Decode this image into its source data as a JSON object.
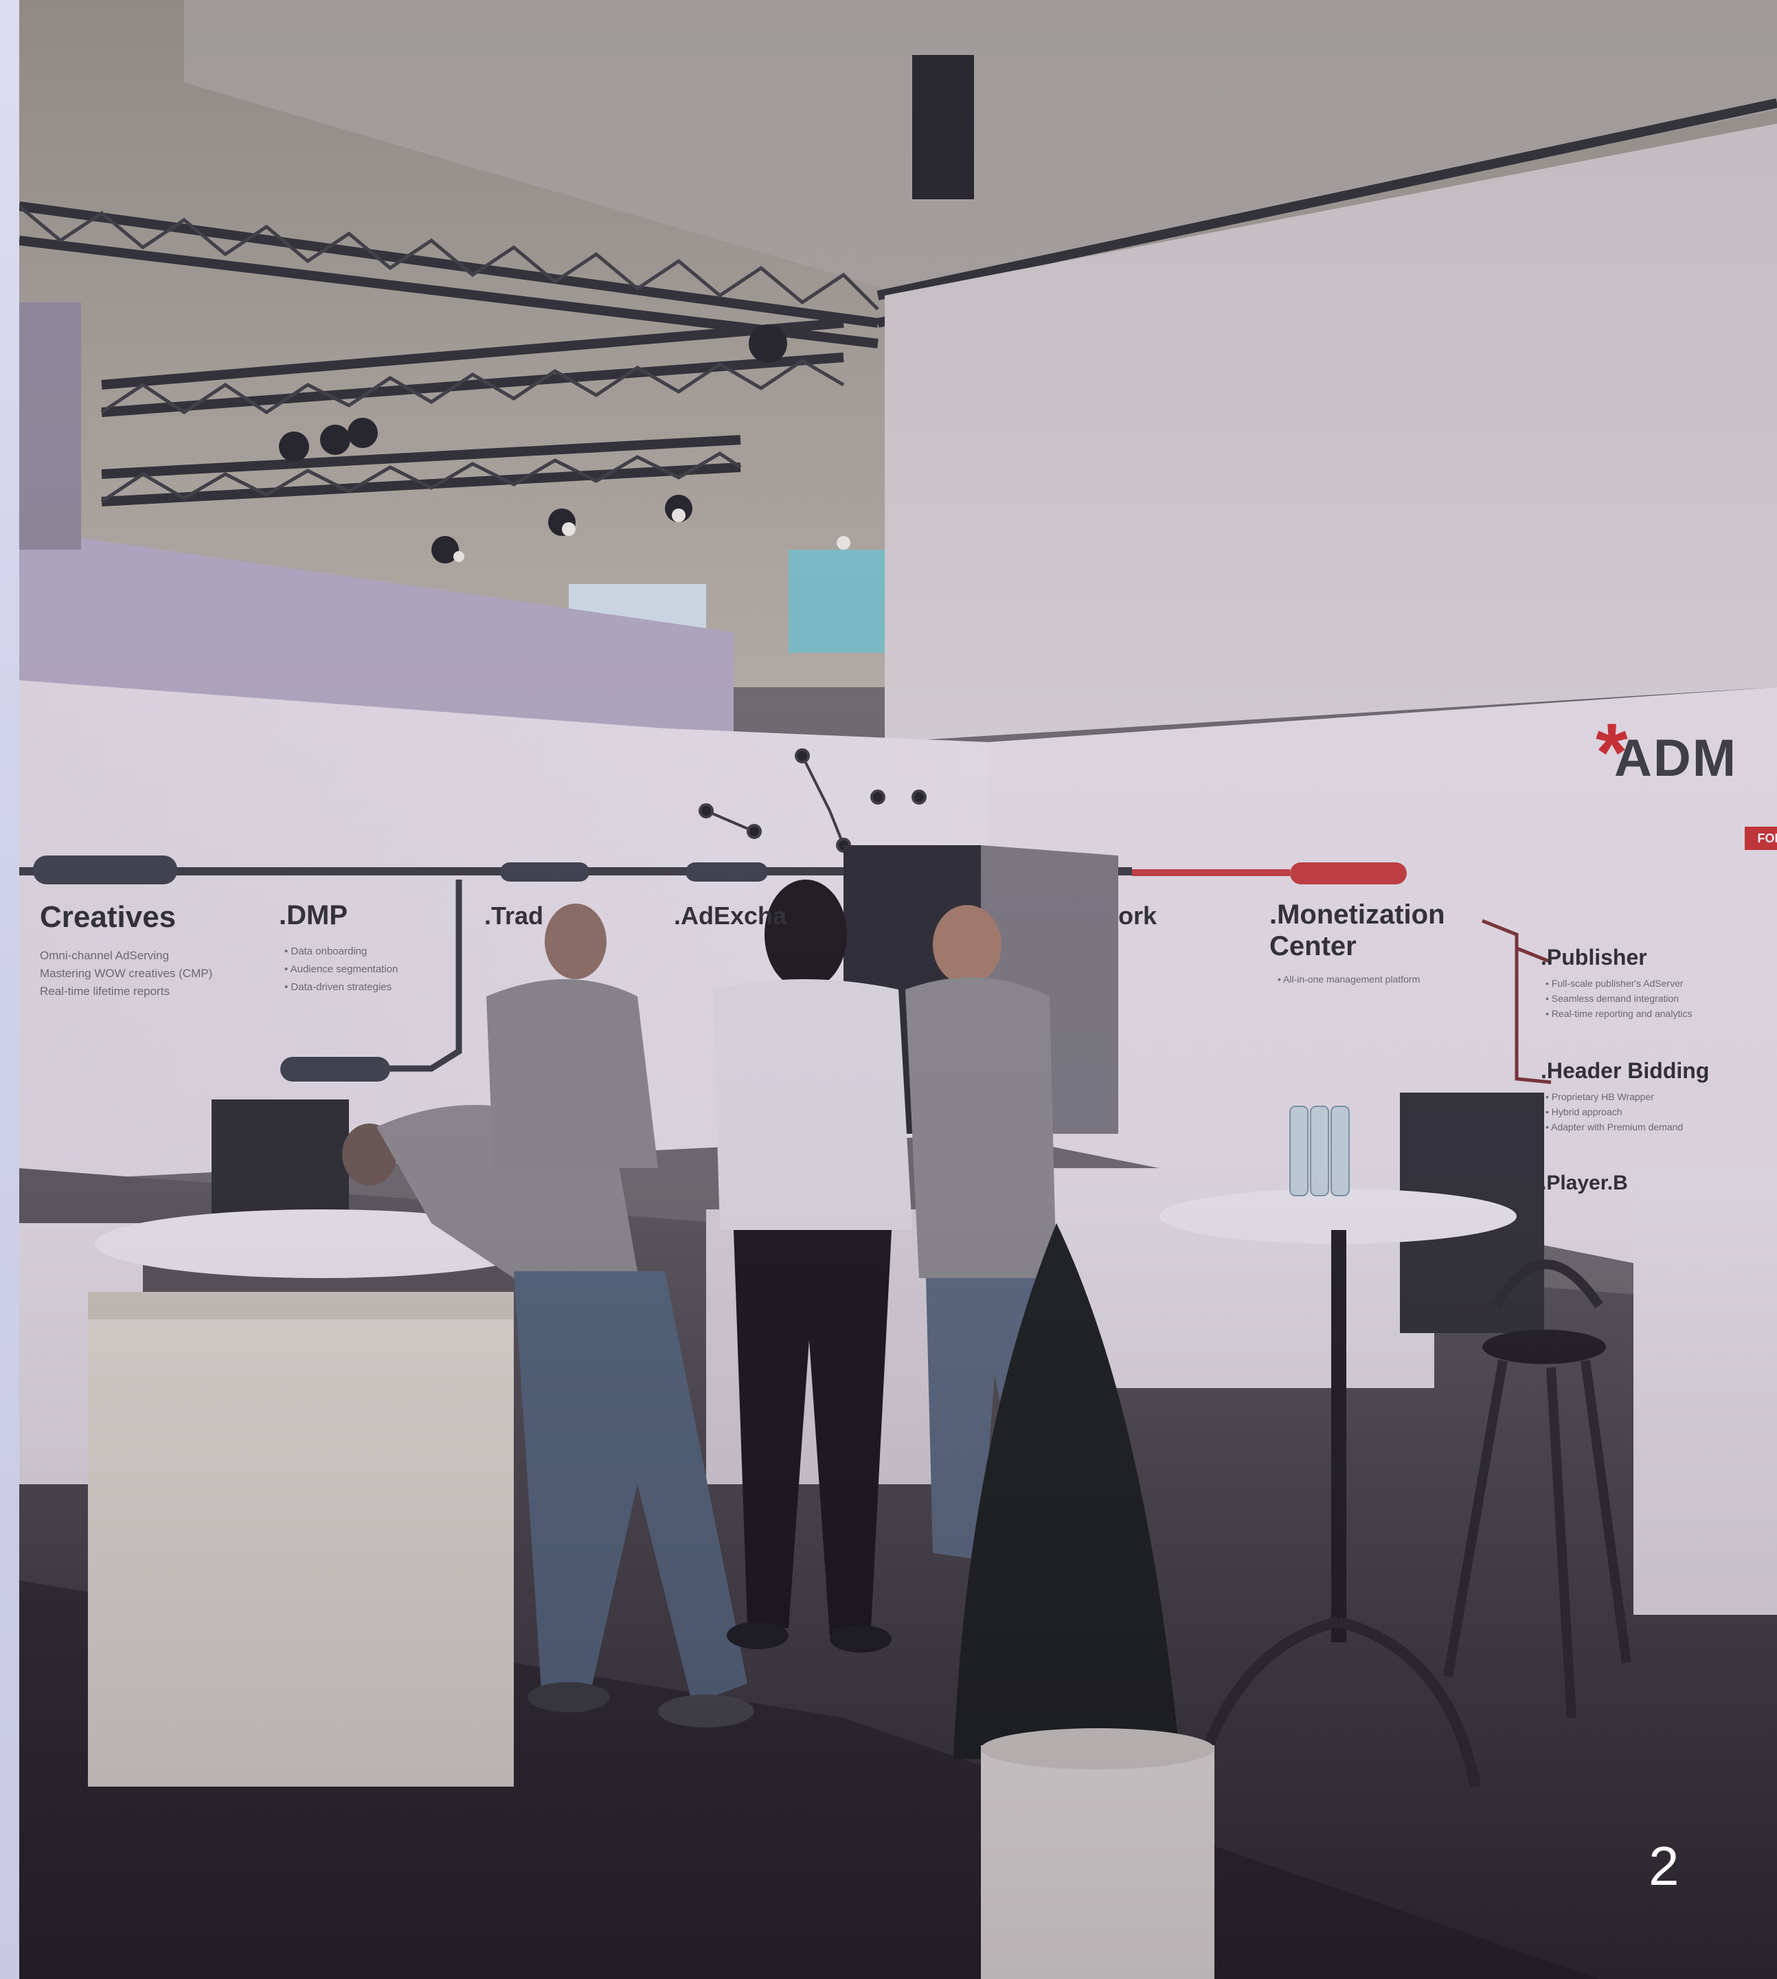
{
  "booth": {
    "brand": "ADM",
    "brand_tag": "FOR",
    "sections": [
      {
        "title": "Creatives",
        "subtitle": "Omni-channel AdServing\nMastering WOW creatives (CMP)\nReal-time lifetime reports"
      },
      {
        "title": ".DMP",
        "subtitle": "• Data onboarding\n• Audience segmentation\n• Data-driven strategies"
      },
      {
        "title": ".Trad",
        "subtitle": ""
      },
      {
        "title": ".AdExcha",
        "subtitle": ""
      },
      {
        "title": "ork",
        "subtitle": ""
      },
      {
        "title": ".Monetization\nCenter",
        "subtitle": "• All-in-one management platform"
      },
      {
        "title": ".Publisher",
        "subtitle": "• Full-scale publisher's AdServer\n• Seamless demand integration\n• Real-time reporting and analytics"
      },
      {
        "title": ".Header Bidding",
        "subtitle": "• Proprietary HB Wrapper\n• Hybrid approach\n• Adapter with Premium demand"
      },
      {
        "title": ".Player.B",
        "subtitle": ""
      }
    ]
  },
  "page_number": "2",
  "colors": {
    "accent_red": "#cf2a2a",
    "background": "#d9d9ee"
  }
}
